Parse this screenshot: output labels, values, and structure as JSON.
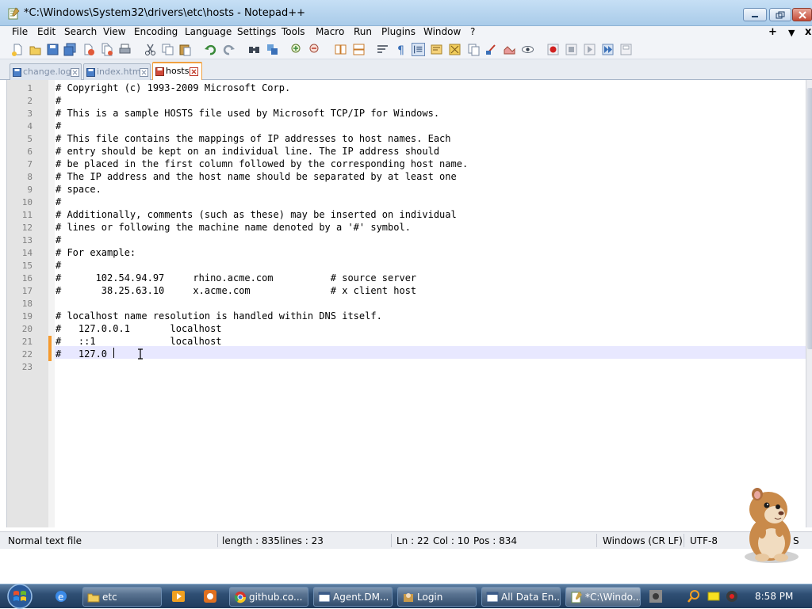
{
  "window": {
    "title": "*C:\\Windows\\System32\\drivers\\etc\\hosts - Notepad++"
  },
  "menubar": {
    "items": [
      "File",
      "Edit",
      "Search",
      "View",
      "Encoding",
      "Language",
      "Settings",
      "Tools",
      "Macro",
      "Run",
      "Plugins",
      "Window",
      "?"
    ],
    "right_controls": [
      "+",
      "▼",
      "x"
    ]
  },
  "tabs": [
    {
      "label": "change.log",
      "active": false
    },
    {
      "label": "index.html",
      "active": false
    },
    {
      "label": "hosts",
      "active": true
    }
  ],
  "editor": {
    "lines": [
      "# Copyright (c) 1993-2009 Microsoft Corp.",
      "#",
      "# This is a sample HOSTS file used by Microsoft TCP/IP for Windows.",
      "#",
      "# This file contains the mappings of IP addresses to host names. Each",
      "# entry should be kept on an individual line. The IP address should",
      "# be placed in the first column followed by the corresponding host name.",
      "# The IP address and the host name should be separated by at least one",
      "# space.",
      "#",
      "# Additionally, comments (such as these) may be inserted on individual",
      "# lines or following the machine name denoted by a '#' symbol.",
      "#",
      "# For example:",
      "#",
      "#      102.54.94.97     rhino.acme.com          # source server",
      "#       38.25.63.10     x.acme.com              # x client host",
      "",
      "# localhost name resolution is handled within DNS itself.",
      "#   127.0.0.1       localhost",
      "#   ::1             localhost",
      "#   127.0",
      ""
    ],
    "line_numbers": [
      "1",
      "2",
      "3",
      "4",
      "5",
      "6",
      "7",
      "8",
      "9",
      "10",
      "11",
      "12",
      "13",
      "14",
      "15",
      "16",
      "17",
      "18",
      "19",
      "20",
      "21",
      "22",
      "23"
    ],
    "current_line": 22,
    "changed_lines": [
      21,
      22
    ]
  },
  "statusbar": {
    "file_type": "Normal text file",
    "length": "length : 835",
    "lines": "lines : 23",
    "ln": "Ln : 22",
    "col": "Col : 10",
    "pos": "Pos : 834",
    "eol": "Windows (CR LF)",
    "encoding": "UTF-8",
    "mode": "S"
  },
  "taskbar": {
    "tasks": [
      {
        "label": "etc",
        "icon": "folder-icon"
      },
      {
        "label": "github.co...",
        "icon": "chrome-icon"
      },
      {
        "label": "Agent.DM...",
        "icon": "window-icon"
      },
      {
        "label": "Login",
        "icon": "login-icon"
      },
      {
        "label": "All Data En...",
        "icon": "window-icon"
      },
      {
        "label": "*C:\\Windo...",
        "icon": "notepadpp-icon"
      }
    ],
    "clock": "8:58 PM"
  },
  "colors": {
    "title_bar": "#b8d5ef",
    "active_tab_accent": "#f0a040",
    "current_line": "#e8e8ff",
    "change_marker": "#f59a2e",
    "taskbar": "#2f4f74"
  }
}
